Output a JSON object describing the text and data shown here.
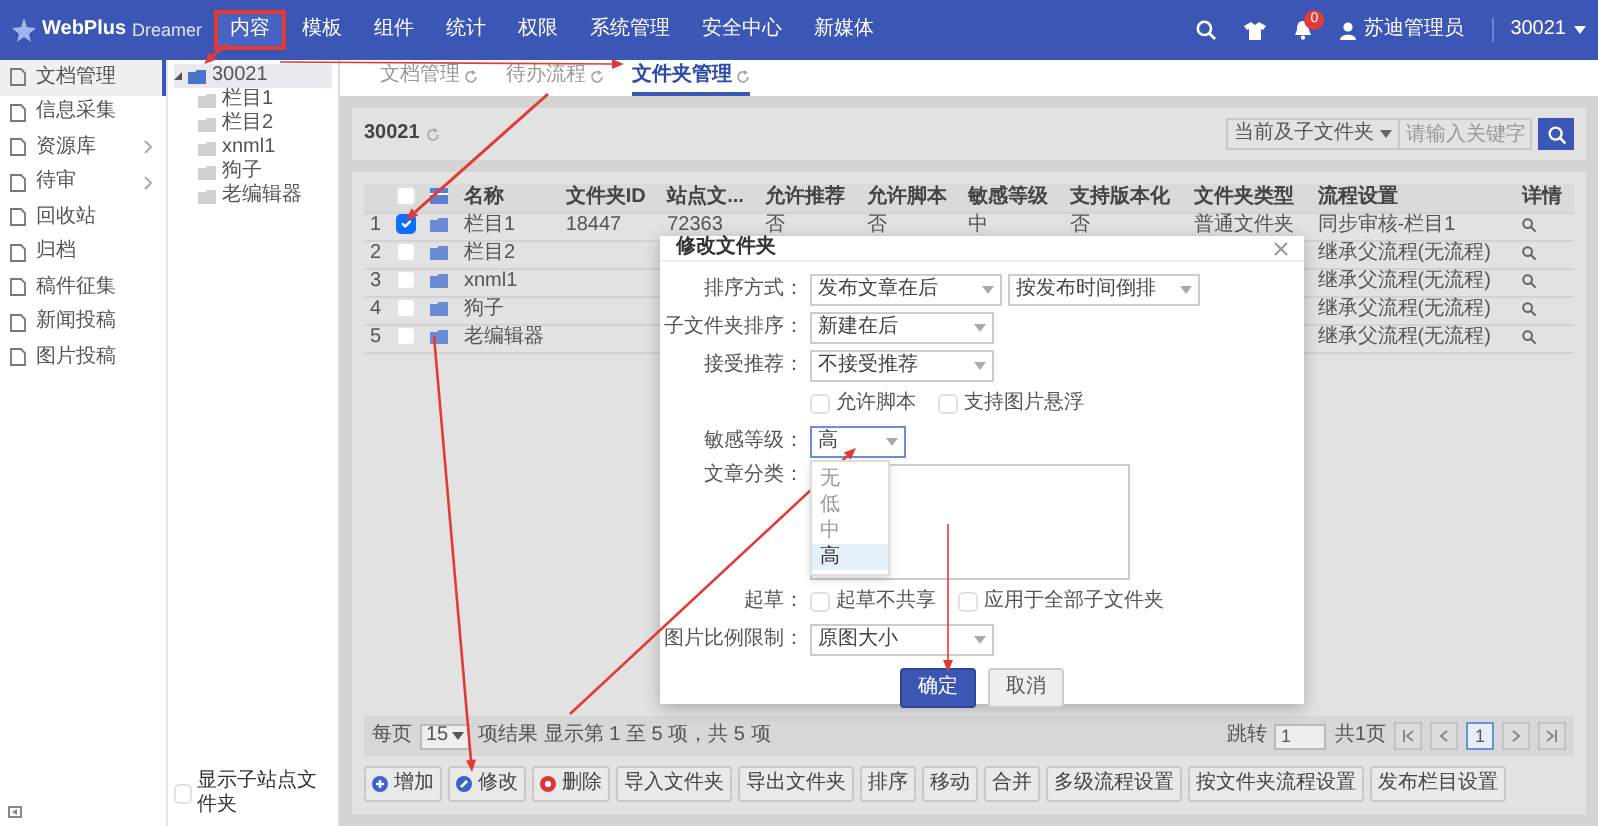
{
  "top_nav": {
    "brand": "WebPlus",
    "product": "Dreamer",
    "items": [
      {
        "label": "内容",
        "selected": true,
        "highlighted": true
      },
      {
        "label": "模板",
        "selected": false,
        "highlighted": false
      },
      {
        "label": "组件",
        "selected": false,
        "highlighted": false
      },
      {
        "label": "统计",
        "selected": false,
        "highlighted": false
      },
      {
        "label": "权限",
        "selected": false,
        "highlighted": false
      },
      {
        "label": "系统管理",
        "selected": false,
        "highlighted": false
      },
      {
        "label": "安全中心",
        "selected": false,
        "highlighted": false
      },
      {
        "label": "新媒体",
        "selected": false,
        "highlighted": false
      }
    ],
    "notification_count": "0",
    "user": "苏迪管理员",
    "site": "30021"
  },
  "sidebar": {
    "items": [
      {
        "label": "文档管理",
        "selected": true,
        "has_submenu": false
      },
      {
        "label": "信息采集",
        "selected": false,
        "has_submenu": false
      },
      {
        "label": "资源库",
        "selected": false,
        "has_submenu": true
      },
      {
        "label": "待审",
        "selected": false,
        "has_submenu": true
      },
      {
        "label": "回收站",
        "selected": false,
        "has_submenu": false
      },
      {
        "label": "归档",
        "selected": false,
        "has_submenu": false
      },
      {
        "label": "稿件征集",
        "selected": false,
        "has_submenu": false
      },
      {
        "label": "新闻投稿",
        "selected": false,
        "has_submenu": false
      },
      {
        "label": "图片投稿",
        "selected": false,
        "has_submenu": false
      }
    ]
  },
  "tree": {
    "nodes": [
      {
        "label": "30021",
        "selected": true,
        "expanded": true,
        "children": [
          {
            "label": "栏目1",
            "selected": false
          },
          {
            "label": "栏目2",
            "selected": false
          },
          {
            "label": "xnml1",
            "selected": false
          },
          {
            "label": "狗子",
            "selected": false
          },
          {
            "label": "老编辑器",
            "selected": false
          }
        ]
      }
    ],
    "show_subsite_folders": {
      "label": "显示子站点文件夹",
      "checked": false
    }
  },
  "tabs": [
    {
      "label": "文档管理",
      "selected": false
    },
    {
      "label": "待办流程",
      "selected": false
    },
    {
      "label": "文件夹管理",
      "selected": true
    }
  ],
  "panel": {
    "title": "30021",
    "scope": "当前及子文件夹",
    "search": {
      "placeholder": "请输入关键字"
    }
  },
  "table": {
    "select_all_checked": false,
    "columns": [
      "名称",
      "文件夹ID",
      "站点文...",
      "允许推荐",
      "允许脚本",
      "敏感等级",
      "支持版本化",
      "文件夹类型",
      "流程设置",
      "详情"
    ],
    "rows": [
      {
        "index": "1",
        "checked": true,
        "name": "栏目1",
        "attributes": [
          "18447",
          "72363",
          "否",
          "否",
          "中",
          "否",
          "普通文件夹"
        ],
        "workflow": "同步审核-栏目1"
      },
      {
        "index": "2",
        "checked": false,
        "name": "栏目2",
        "workflow": "继承父流程(无流程)"
      },
      {
        "index": "3",
        "checked": false,
        "name": "xnml1",
        "workflow": "继承父流程(无流程)"
      },
      {
        "index": "4",
        "checked": false,
        "name": "狗子",
        "workflow": "继承父流程(无流程)"
      },
      {
        "index": "5",
        "checked": false,
        "name": "老编辑器",
        "workflow": "继承父流程(无流程)"
      }
    ]
  },
  "pagination": {
    "per_page_label": "每页",
    "per_page": "15",
    "summary": "项结果 显示第 1 至 5 项，共 5 项",
    "jump_label": "跳转",
    "page_input": "1",
    "total": "共1页",
    "pages": [
      {
        "label": "1",
        "selected": true
      }
    ]
  },
  "toolbar": [
    {
      "label": "增加",
      "kind": "add"
    },
    {
      "label": "修改",
      "kind": "edit"
    },
    {
      "label": "删除",
      "kind": "delete"
    },
    {
      "label": "导入文件夹",
      "kind": "plain"
    },
    {
      "label": "导出文件夹",
      "kind": "plain"
    },
    {
      "label": "排序",
      "kind": "plain"
    },
    {
      "label": "移动",
      "kind": "plain"
    },
    {
      "label": "合并",
      "kind": "plain"
    },
    {
      "label": "多级流程设置",
      "kind": "plain"
    },
    {
      "label": "按文件夹流程设置",
      "kind": "plain"
    },
    {
      "label": "发布栏目设置",
      "kind": "plain"
    }
  ],
  "dialog": {
    "title": "修改文件夹",
    "fields": [
      {
        "kind": "select_pair",
        "label": "排序方式：",
        "values": [
          "发布文章在后",
          "按发布时间倒排"
        ]
      },
      {
        "kind": "select",
        "label": "子文件夹排序：",
        "value": "新建在后"
      },
      {
        "kind": "select",
        "label": "接受推荐：",
        "value": "不接受推荐"
      },
      {
        "kind": "checks",
        "options": [
          {
            "label": "允许脚本",
            "checked": false
          },
          {
            "label": "支持图片悬浮",
            "checked": false
          }
        ]
      },
      {
        "kind": "dropdown",
        "label": "敏感等级：",
        "value": "高",
        "open": true,
        "options": [
          {
            "label": "无",
            "selected": false
          },
          {
            "label": "低",
            "selected": false
          },
          {
            "label": "中",
            "selected": false
          },
          {
            "label": "高",
            "selected": true
          }
        ]
      },
      {
        "kind": "listbox",
        "label": "文章分类："
      },
      {
        "kind": "checks",
        "label": "起草：",
        "options": [
          {
            "label": "起草不共享",
            "checked": false
          },
          {
            "label": "应用于全部子文件夹",
            "checked": false
          }
        ]
      },
      {
        "kind": "select",
        "label": "图片比例限制：",
        "value": "原图大小"
      }
    ],
    "buttons": [
      {
        "label": "确定",
        "kind": "primary"
      },
      {
        "label": "取消",
        "kind": "secondary"
      }
    ]
  }
}
